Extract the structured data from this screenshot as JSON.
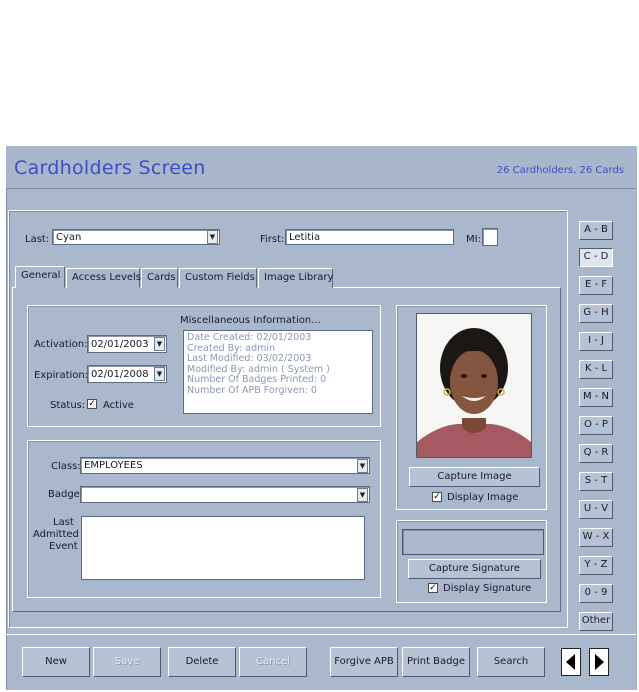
{
  "window": {
    "title": "Cardholders Screen",
    "count_text": "26 Cardholders, 26 Cards"
  },
  "name_row": {
    "last_label": "Last:",
    "last_value": "Cyan",
    "first_label": "First:",
    "first_value": "Letitia",
    "mi_label": "MI:",
    "mi_value": ""
  },
  "tabs": [
    {
      "label": "General",
      "active": true
    },
    {
      "label": "Access Levels",
      "active": false
    },
    {
      "label": "Cards",
      "active": false
    },
    {
      "label": "Custom Fields",
      "active": false
    },
    {
      "label": "Image Library",
      "active": false
    }
  ],
  "general": {
    "activation_label": "Activation:",
    "activation_value": "02/01/2003",
    "expiration_label": "Expiration:",
    "expiration_value": "02/01/2008",
    "status_label": "Status:",
    "active_label": "Active",
    "active_checked": true,
    "misc_title": "Miscellaneous Information...",
    "misc_lines": [
      "Date Created: 02/01/2003",
      "Created By: admin",
      "Last Modified: 03/02/2003",
      "Modified By: admin ( System )",
      "Number Of Badges Printed: 0",
      "Number Of APB Forgiven: 0"
    ],
    "class_label": "Class:",
    "class_value": "EMPLOYEES",
    "badge_label": "Badge:",
    "badge_value": "",
    "last_event_label_1": "Last",
    "last_event_label_2": "Admitted",
    "last_event_label_3": "Event"
  },
  "image_panel": {
    "capture_image_label": "Capture Image",
    "display_image_label": "Display Image",
    "display_image_checked": true,
    "capture_signature_label": "Capture Signature",
    "display_signature_label": "Display Signature",
    "display_signature_checked": true
  },
  "alpha_index": [
    "A - B",
    "C - D",
    "E - F",
    "G - H",
    "I - J",
    "K - L",
    "M - N",
    "O - P",
    "Q - R",
    "S - T",
    "U - V",
    "W - X",
    "Y - Z",
    "0 - 9",
    "Other"
  ],
  "alpha_selected": "C - D",
  "toolbar": {
    "new": "New",
    "save": "Save",
    "delete": "Delete",
    "cancel": "Cancel",
    "forgive_apb": "Forgive APB",
    "print_badge": "Print Badge",
    "search": "Search"
  },
  "colors": {
    "accent": "#3b4fc4",
    "panel": "#a9b8cc",
    "disabled_text": "#8b97b8"
  }
}
